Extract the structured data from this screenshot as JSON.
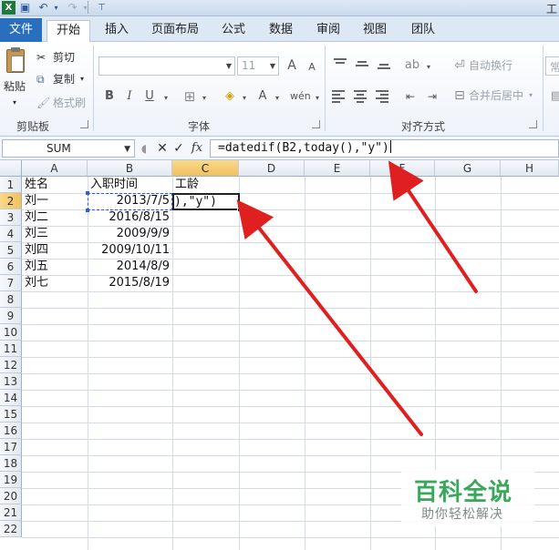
{
  "window": {
    "title": "工"
  },
  "quick_access": {
    "icons": [
      "excel-logo-icon",
      "save-icon",
      "undo-icon",
      "redo-icon",
      "customize-icon"
    ]
  },
  "tabs": [
    {
      "label": "文件"
    },
    {
      "label": "开始"
    },
    {
      "label": "插入"
    },
    {
      "label": "页面布局"
    },
    {
      "label": "公式"
    },
    {
      "label": "数据"
    },
    {
      "label": "审阅"
    },
    {
      "label": "视图"
    },
    {
      "label": "团队"
    }
  ],
  "active_tab": "开始",
  "ribbon": {
    "clipboard": {
      "paste": "粘贴",
      "cut": "剪切",
      "copy": "复制",
      "format_painter": "格式刷",
      "group": "剪贴板"
    },
    "font": {
      "font_size": "11",
      "bold": "B",
      "italic": "I",
      "underline": "U",
      "grow": "A",
      "shrink": "A",
      "font_color": "A",
      "group": "字体"
    },
    "alignment": {
      "wrap": "自动换行",
      "merge": "合并后居中",
      "group": "对齐方式"
    },
    "number": {
      "format": "常"
    }
  },
  "formula_bar": {
    "name_box": "SUM",
    "cancel": "✕",
    "enter": "✓",
    "fx": "fx",
    "formula": "=datedif(B2,today(),\"y\")"
  },
  "sheet": {
    "columns": [
      "A",
      "B",
      "C",
      "D",
      "E",
      "F",
      "G",
      "H"
    ],
    "rows": [
      "1",
      "2",
      "3",
      "4",
      "5",
      "6",
      "7",
      "8",
      "9",
      "10",
      "11",
      "12",
      "13",
      "14",
      "15",
      "16",
      "17",
      "18",
      "19",
      "20",
      "21",
      "22"
    ],
    "header": {
      "name": "姓名",
      "hire_date": "入职时间",
      "seniority": "工龄"
    },
    "data": [
      {
        "name": "刘一",
        "hire_date": "2013/7/5"
      },
      {
        "name": "刘二",
        "hire_date": "2016/8/15"
      },
      {
        "name": "刘三",
        "hire_date": "2009/9/9"
      },
      {
        "name": "刘四",
        "hire_date": "2009/10/11"
      },
      {
        "name": "刘五",
        "hire_date": "2014/8/9"
      },
      {
        "name": "刘七",
        "hire_date": "2015/8/19"
      }
    ],
    "editing_cell_text": "),\"y\")"
  },
  "watermark": {
    "title": "百科全说",
    "subtitle": "助你轻松解决"
  },
  "colors": {
    "file_tab": "#2a6fbe",
    "selected_header": "#f1c15f",
    "arrow": "#e02020",
    "watermark": "#3aa85c"
  }
}
